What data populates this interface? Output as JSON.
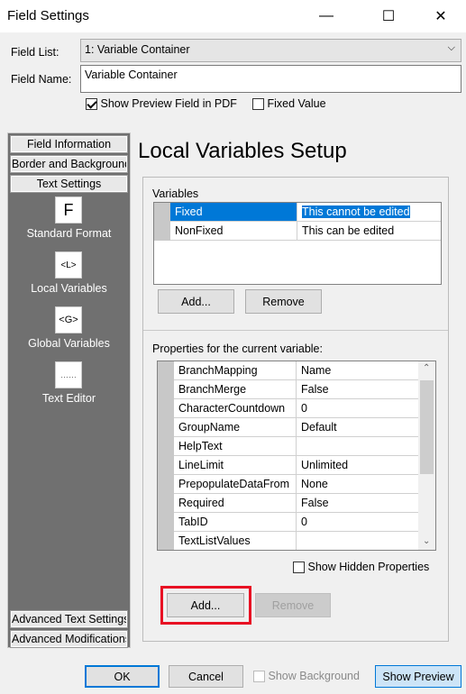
{
  "window": {
    "title": "Field Settings",
    "minimize": "—",
    "maximize": "☐",
    "close": "✕"
  },
  "field_list": {
    "label": "Field List:",
    "value": "1: Variable Container"
  },
  "field_name": {
    "label": "Field Name:",
    "value": "Variable Container"
  },
  "options": {
    "show_preview_pdf": {
      "label": "Show Preview Field in PDF",
      "checked": true
    },
    "fixed_value": {
      "label": "Fixed Value",
      "checked": false
    }
  },
  "sidebar": {
    "buttons": [
      "Field Information",
      "Border and Background",
      "Text Settings"
    ],
    "items": [
      {
        "glyph": "F",
        "label": "Standard Format"
      },
      {
        "glyph": "<L>",
        "label": "Local Variables"
      },
      {
        "glyph": "<G>",
        "label": "Global Variables"
      },
      {
        "glyph": "……",
        "label": "Text Editor"
      }
    ],
    "bottom_buttons": [
      "Advanced Text Settings",
      "Advanced Modifications"
    ]
  },
  "main": {
    "heading": "Local Variables Setup",
    "variables": {
      "label": "Variables",
      "rows": [
        {
          "name": "Fixed",
          "value": "This cannot be edited",
          "selected": true
        },
        {
          "name": "NonFixed",
          "value": "This can be edited",
          "selected": false
        }
      ],
      "add": "Add...",
      "remove": "Remove"
    },
    "properties": {
      "label": "Properties for the current variable:",
      "rows": [
        {
          "name": "BranchMapping",
          "value": "Name"
        },
        {
          "name": "BranchMerge",
          "value": "False"
        },
        {
          "name": "CharacterCountdown",
          "value": "0"
        },
        {
          "name": "GroupName",
          "value": "Default"
        },
        {
          "name": "HelpText",
          "value": ""
        },
        {
          "name": "LineLimit",
          "value": "Unlimited"
        },
        {
          "name": "PrepopulateDataFrom",
          "value": "None"
        },
        {
          "name": "Required",
          "value": "False"
        },
        {
          "name": "TabID",
          "value": "0"
        },
        {
          "name": "TextListValues",
          "value": ""
        }
      ],
      "show_hidden": {
        "label": "Show Hidden Properties",
        "checked": false
      },
      "add": "Add...",
      "remove": "Remove"
    }
  },
  "footer": {
    "ok": "OK",
    "cancel": "Cancel",
    "show_background": {
      "label": "Show Background",
      "checked": false
    },
    "show_preview": "Show Preview"
  },
  "colors": {
    "selection": "#0078d7",
    "highlight": "#e81123",
    "sidebar": "#707070"
  }
}
